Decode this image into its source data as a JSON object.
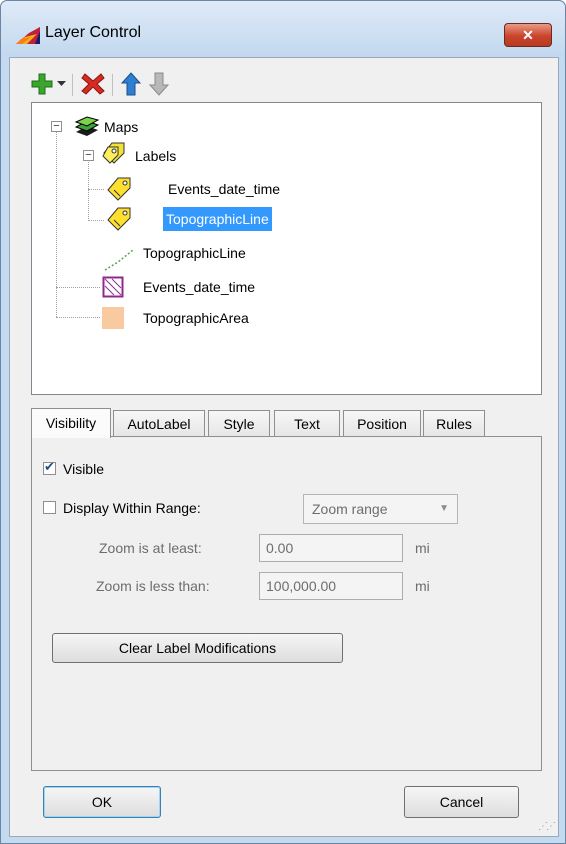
{
  "window": {
    "title": "Layer Control",
    "close_label": "✕"
  },
  "toolbar": {
    "add": {
      "icon": "green-plus-icon",
      "color": "#3aa62e"
    },
    "remove": {
      "icon": "red-x-icon",
      "color": "#d62b23"
    },
    "move_up": {
      "icon": "blue-up-arrow-icon",
      "color": "#2f7fd1"
    },
    "move_down": {
      "icon": "grey-down-arrow-icon",
      "color": "#9a9a9a"
    }
  },
  "tree": {
    "maps": "Maps",
    "labels": "Labels",
    "labels_events": "Events_date_time",
    "labels_topo_line": "TopographicLine",
    "topo_line": "TopographicLine",
    "events": "Events_date_time",
    "topo_area": "TopographicArea"
  },
  "tabs": [
    "Visibility",
    "AutoLabel",
    "Style",
    "Text",
    "Position",
    "Rules"
  ],
  "visibility": {
    "visible_label": "Visible",
    "visible_checked": true,
    "display_range_label": "Display Within Range:",
    "display_range_checked": false,
    "zoom_range_value": "Zoom range",
    "zoom_min_label": "Zoom is at least:",
    "zoom_min_value": "0.00",
    "zoom_min_unit": "mi",
    "zoom_max_label": "Zoom is less than:",
    "zoom_max_value": "100,000.00",
    "zoom_max_unit": "mi",
    "clear_button": "Clear Label Modifications"
  },
  "footer": {
    "ok": "OK",
    "cancel": "Cancel"
  },
  "colors": {
    "selection": "#3399ff",
    "topographic_area_swatch": "#f9c9a0",
    "events_swatch_border": "#8e2a8e"
  }
}
